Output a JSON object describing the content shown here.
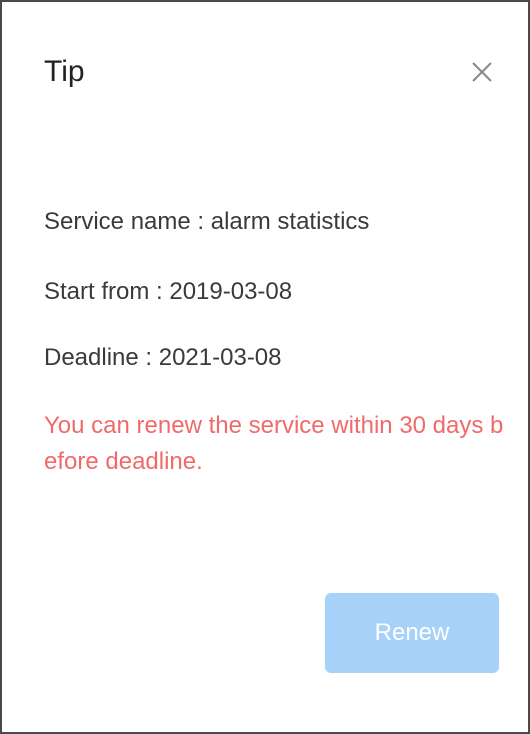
{
  "dialog": {
    "title": "Tip",
    "close_icon": "close-icon"
  },
  "info": {
    "service_name": "Service name : alarm statistics",
    "start_from": "Start from : 2019-03-08",
    "deadline": "Deadline : 2021-03-08"
  },
  "warning": "You can renew the service within 30 days before deadline.",
  "actions": {
    "renew_label": "Renew",
    "renew_disabled": true
  },
  "colors": {
    "warning_text": "#f06a6a",
    "renew_button_bg": "#a6d2fa",
    "border": "#4a4a4a"
  }
}
